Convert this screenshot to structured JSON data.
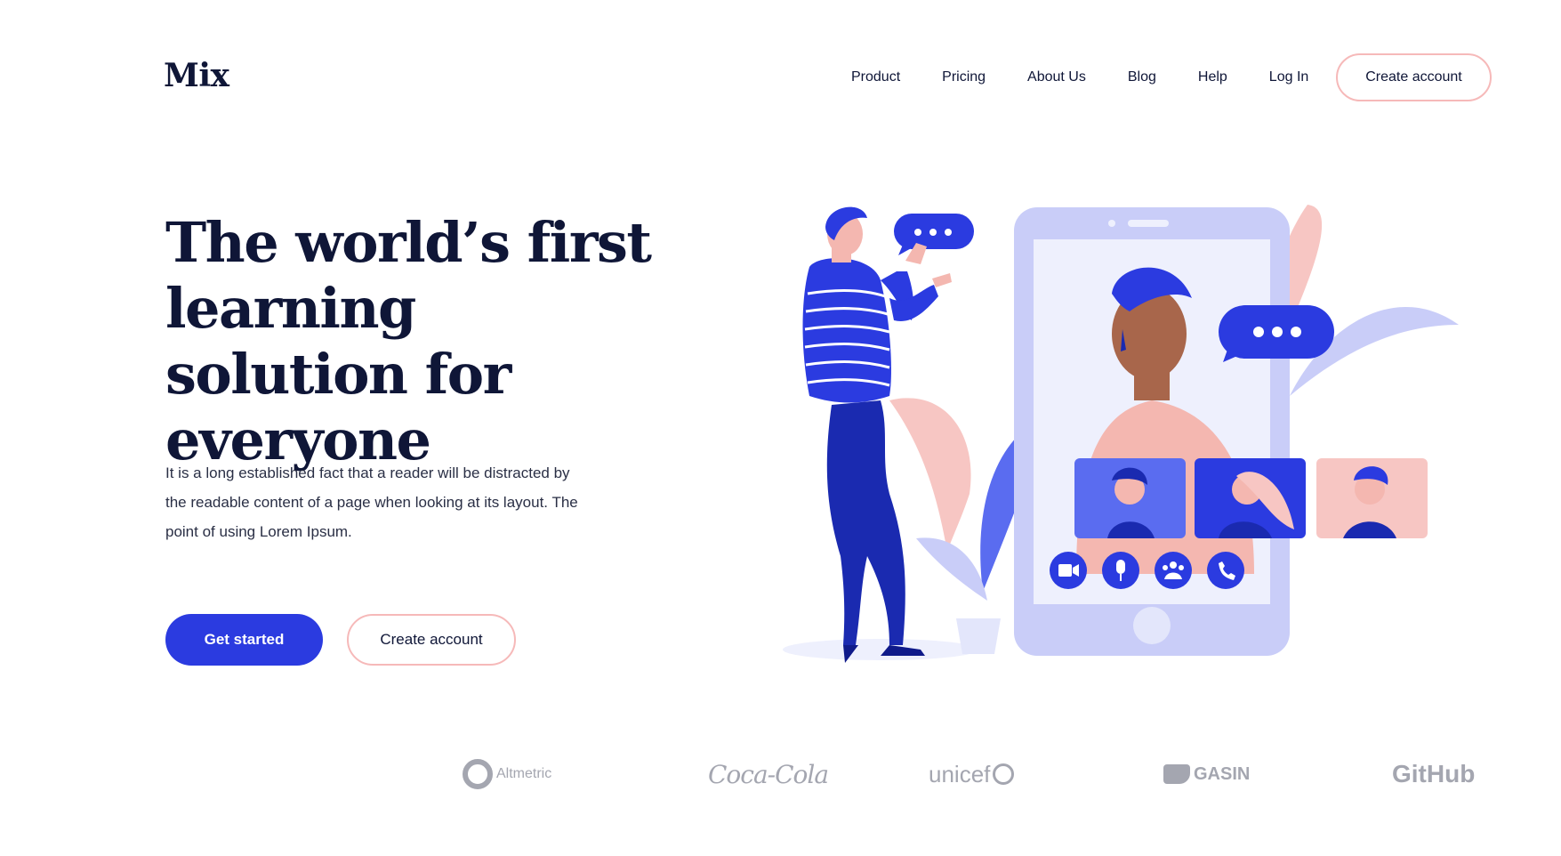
{
  "brand": {
    "logo": "Mix"
  },
  "nav": {
    "items": [
      {
        "label": "Product"
      },
      {
        "label": "Pricing"
      },
      {
        "label": "About Us"
      },
      {
        "label": "Blog"
      },
      {
        "label": "Help"
      },
      {
        "label": "Log In"
      }
    ],
    "cta": "Create account"
  },
  "hero": {
    "title": "The world’s first learning solution for everyone",
    "description": "It is a long established fact that a reader will be distracted by the readable content of a page when looking at its layout. The point of using Lorem Ipsum.",
    "primary_button": "Get started",
    "secondary_button": "Create account"
  },
  "partners": {
    "altmetric": "Altmetric",
    "cocacola": "Coca-Cola",
    "unicef": "unicef",
    "gasin": "GASIN",
    "github": "GitHub"
  },
  "colors": {
    "primary": "#2b3be0",
    "text_dark": "#0f1637",
    "outline_pink": "#f6b9b9",
    "phone_light": "#c9cdf8",
    "skin_pink": "#f4b7b0"
  },
  "icons": [
    "video-icon",
    "microphone-icon",
    "group-icon",
    "phone-icon",
    "chat-bubble-icon"
  ]
}
